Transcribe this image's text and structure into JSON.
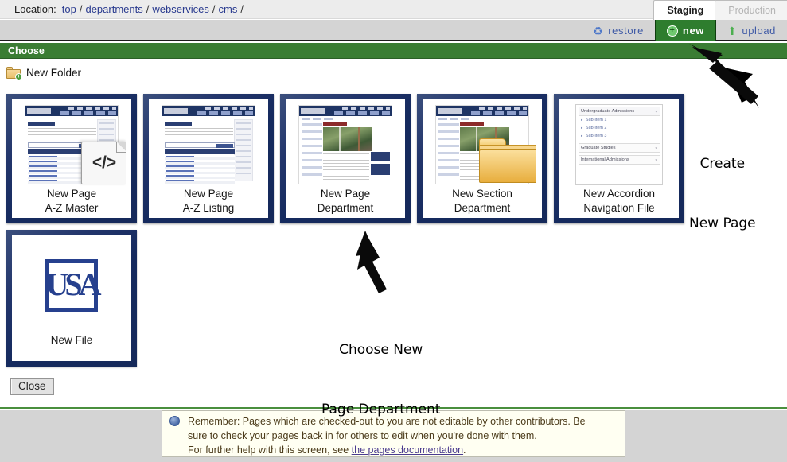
{
  "location_bar": {
    "label": "Location:",
    "crumbs": [
      "top",
      "departments",
      "webservices",
      "cms"
    ],
    "separator": "/"
  },
  "env_tabs": [
    {
      "label": "Staging",
      "state": "active"
    },
    {
      "label": "Production",
      "state": "inactive"
    }
  ],
  "action_bar": {
    "restore": {
      "label": "restore",
      "icon": "recycle-icon"
    },
    "new": {
      "label": "new",
      "icon": "plus-circle-icon",
      "state": "active"
    },
    "upload": {
      "label": "upload",
      "icon": "upload-arrow-icon"
    }
  },
  "choose_header": {
    "title": "Choose"
  },
  "new_folder": {
    "label": "New Folder",
    "icon": "folder-add-icon"
  },
  "cards": [
    {
      "id": "new-page-az-master",
      "line1": "New Page",
      "line2": "A-Z Master",
      "thumb": "site-az-master-with-code-file"
    },
    {
      "id": "new-page-az-listing",
      "line1": "New Page",
      "line2": "A-Z Listing",
      "thumb": "site-az-listing"
    },
    {
      "id": "new-page-department",
      "line1": "New Page",
      "line2": "Department",
      "thumb": "site-department"
    },
    {
      "id": "new-section-department",
      "line1": "New Section",
      "line2": "Department",
      "thumb": "site-department-with-folder"
    },
    {
      "id": "new-accordion-navigation",
      "line1": "New Accordion",
      "line2": "Navigation File",
      "thumb": "accordion-nav"
    },
    {
      "id": "new-file",
      "line1": "New File",
      "line2": "",
      "thumb": "usa-logo"
    }
  ],
  "accordion_preview": {
    "items": [
      {
        "label": "Undergraduate Admissions",
        "open": true,
        "subitems": [
          "Sub-Item 1",
          "Sub-Item 2",
          "Sub-Item 3"
        ]
      },
      {
        "label": "Graduate Studies",
        "open": false,
        "subitems": []
      },
      {
        "label": "International Admissions",
        "open": false,
        "subitems": []
      }
    ]
  },
  "usa_logo": {
    "mark": "USA"
  },
  "close_button": {
    "label": "Close"
  },
  "footer_note": {
    "line1": "Remember: Pages which are checked-out to you are not editable by other contributors. Be",
    "line2": "sure to check your pages back in for others to edit when you're done with them.",
    "line3_pre": "For further help with this screen, see ",
    "line3_link": "the pages documentation",
    "line3_post": "."
  },
  "annotations": [
    {
      "id": "create-new-page",
      "text": "Create\nNew Page"
    },
    {
      "id": "choose-new-page-department",
      "text": "Choose New\nPage Department"
    }
  ],
  "colors": {
    "green_header": "#3a7d33",
    "green_tab": "#2e7d2e",
    "navy_card": "#15295a",
    "link": "#2a3b8f",
    "footer_bg": "#d4d4d4",
    "info_bg": "#fffff2"
  }
}
